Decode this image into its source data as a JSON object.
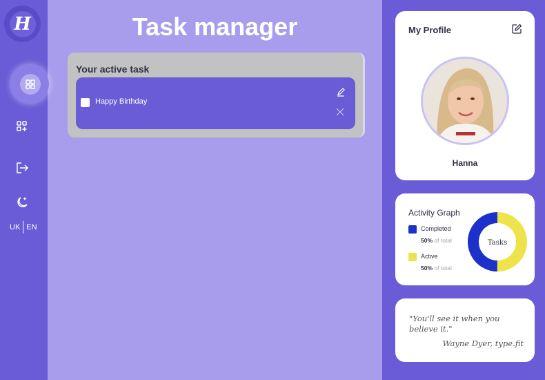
{
  "app": {
    "logo_letter": "H",
    "title": "Task manager"
  },
  "sidebar": {
    "items": [
      {
        "icon": "grid-icon"
      },
      {
        "icon": "add-grid-icon"
      },
      {
        "icon": "logout-icon"
      },
      {
        "icon": "moon-stars-icon"
      }
    ],
    "lang": {
      "uk": "UK",
      "en": "EN"
    }
  },
  "tasks": {
    "heading": "Your active task",
    "items": [
      {
        "name": "Happy Birthday",
        "checked": false
      }
    ]
  },
  "profile": {
    "heading": "My Profile",
    "name": "Hanna"
  },
  "activity": {
    "heading": "Activity Graph",
    "center_label": "Tasks",
    "completed": {
      "label": "Completed",
      "pct": "50%",
      "suffix": "of total",
      "color": "#1b31c9"
    },
    "active": {
      "label": "Active",
      "pct": "50%",
      "suffix": "of total",
      "color": "#ede44c"
    }
  },
  "quote": {
    "text": "\"You'll see it when you believe it.\"",
    "author": "Wayne Dyer, type.fit"
  },
  "colors": {
    "primary": "#6a5bd6",
    "main_bg": "#a89ded",
    "panel": "#c2c2c2"
  }
}
